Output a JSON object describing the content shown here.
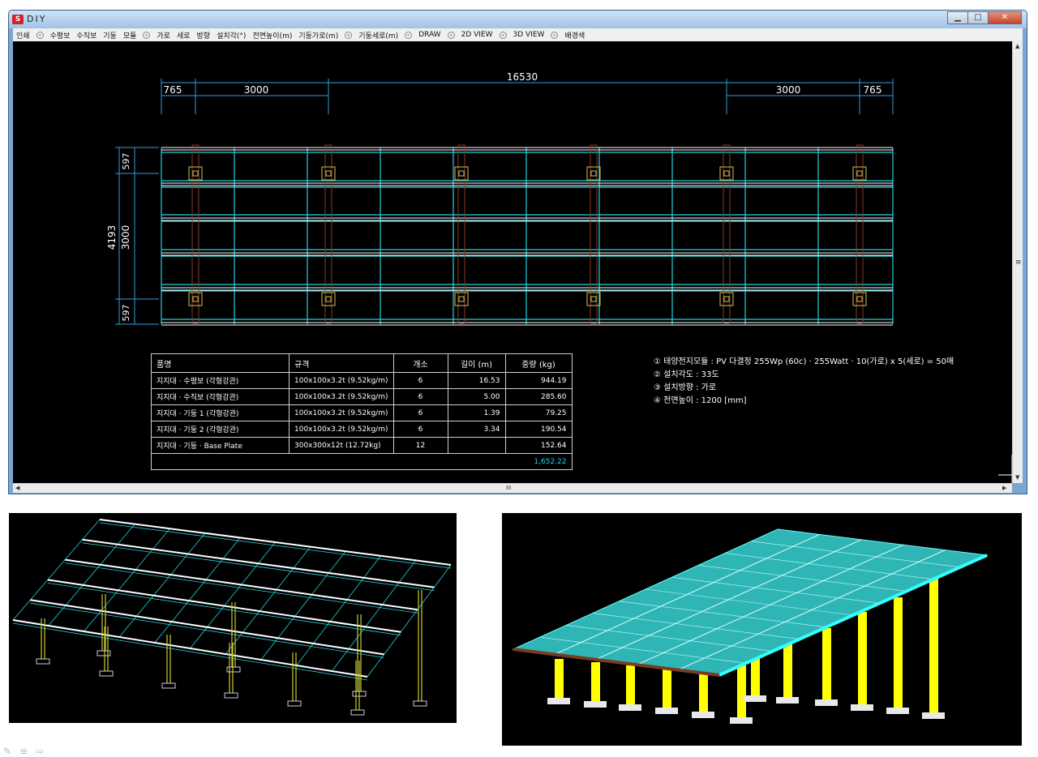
{
  "window": {
    "title": "DIY",
    "app_icon": "S",
    "minimize": "▁",
    "maximize": "□",
    "close": "✕"
  },
  "menu": {
    "items": [
      "인쇄",
      "수평보",
      "수직보",
      "기둥",
      "모듈",
      "가로",
      "세로",
      "방향",
      "설치각(°)",
      "전면높이(m)",
      "기둥가로(m)",
      "기둥세로(m)",
      "DRAW",
      "2D VIEW",
      "3D VIEW",
      "배경색"
    ],
    "separators_after": [
      0,
      4,
      10,
      11,
      12,
      13,
      14
    ]
  },
  "drawing": {
    "dim_total": "16530",
    "dim_left_small": "765",
    "dim_left_span": "3000",
    "dim_right_span": "3000",
    "dim_right_small": "765",
    "dim_v_total": "4193",
    "dim_v_top": "597",
    "dim_v_mid": "3000",
    "dim_v_bottom": "597"
  },
  "bom": {
    "headers": [
      "품명",
      "규격",
      "개소",
      "길이 (m)",
      "중량 (kg)"
    ],
    "rows": [
      [
        "지지대 · 수평보 (각형강관)",
        "100x100x3.2t (9.52kg/m)",
        "6",
        "16.53",
        "944.19"
      ],
      [
        "지지대 · 수직보 (각형강관)",
        "100x100x3.2t (9.52kg/m)",
        "6",
        "5.00",
        "285.60"
      ],
      [
        "지지대 · 기둥 1 (각형강관)",
        "100x100x3.2t (9.52kg/m)",
        "6",
        "1.39",
        "79.25"
      ],
      [
        "지지대 · 기둥 2 (각형강관)",
        "100x100x3.2t (9.52kg/m)",
        "6",
        "3.34",
        "190.54"
      ],
      [
        "지지대 · 기둥 · Base Plate",
        "300x300x12t (12.72kg)",
        "12",
        "",
        "152.64"
      ]
    ],
    "total": "1,652.22"
  },
  "notes": [
    "① 태양전지모듈 :  PV 다결정 255Wp (60c) · 255Watt · 10(가로) x 5(세로) = 50매",
    "② 설치각도 :  33도",
    "③ 설치방향 :  가로",
    "④ 전면높이 :  1200 [mm]"
  ],
  "scroll": {
    "h_thumb": "III",
    "v_thumb": "≡"
  },
  "colors": {
    "canvas_bg": "#000000",
    "beam": "#ffffff",
    "module": "#22d3e0",
    "post": "#8b3a2a",
    "dim": "#2f9ddf",
    "plate": "#d6c24a",
    "post_3d": "#ffff00"
  }
}
